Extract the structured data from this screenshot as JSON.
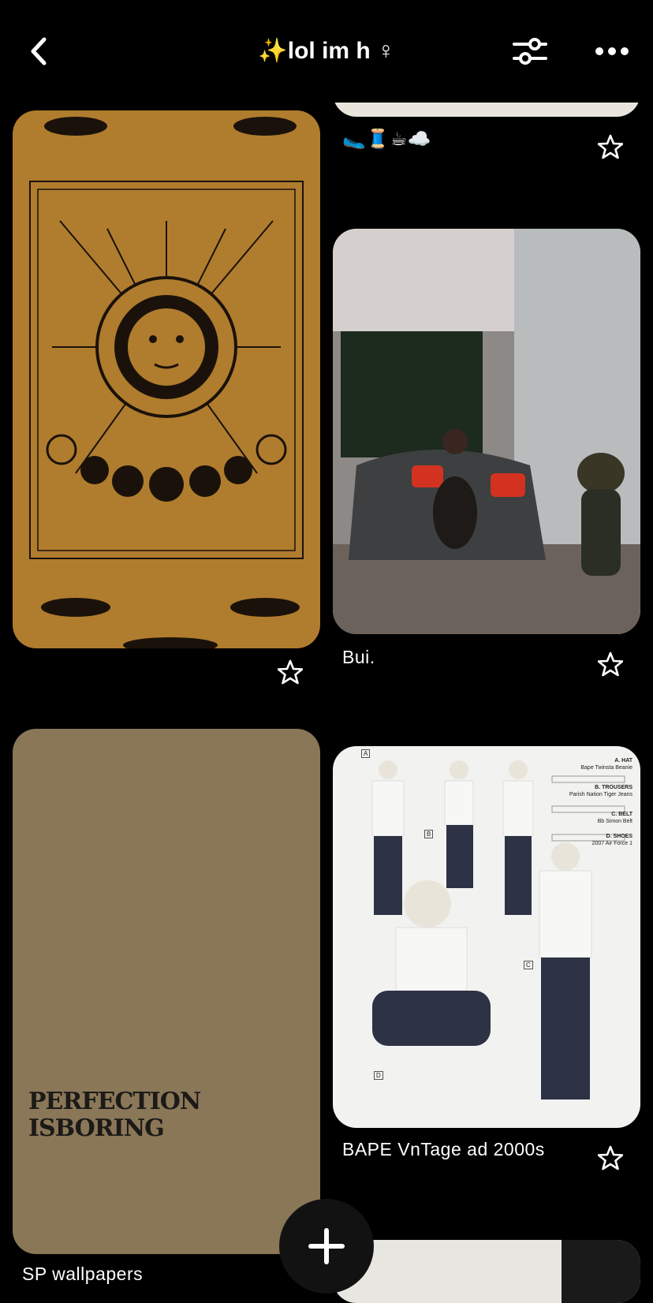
{
  "header": {
    "title": "✨lol im h ♀",
    "back_icon": "chevron-left-icon",
    "filter_icon": "sliders-icon",
    "more_icon": "more-horizontal-icon"
  },
  "pins": [
    {
      "caption": "🥿🧵☕☁️",
      "image": "partially visible pin image"
    },
    {
      "caption": "",
      "image": "sun and moon tarot wallpaper"
    },
    {
      "caption": "Bui.",
      "image": "woman on couch with supreme pillows and bearbrick"
    },
    {
      "caption": "SP wallpapers",
      "image": "tan wallpaper with perfection is boring text",
      "art_text_1": "PERFECTION",
      "art_text_2": "ISBORING"
    },
    {
      "caption": "BAPE VnTage ad  2000s",
      "image": "bape vintage outfit lookbook",
      "labels": [
        {
          "title": "A. HAT",
          "sub": "Bape Twinsta Beanie"
        },
        {
          "title": "B. TROUSERS",
          "sub": "Parish Nation Tiger Jeans"
        },
        {
          "title": "C. BELT",
          "sub": "Bb Simon Belt"
        },
        {
          "title": "D. SHOES",
          "sub": "2007 Air Force 1"
        }
      ],
      "markers": [
        "A",
        "B",
        "C",
        "D"
      ]
    }
  ],
  "fab": {
    "icon": "plus-icon"
  },
  "colors": {
    "background": "#000000",
    "tarot": "#b07c2e",
    "tan": "#8a7758"
  }
}
